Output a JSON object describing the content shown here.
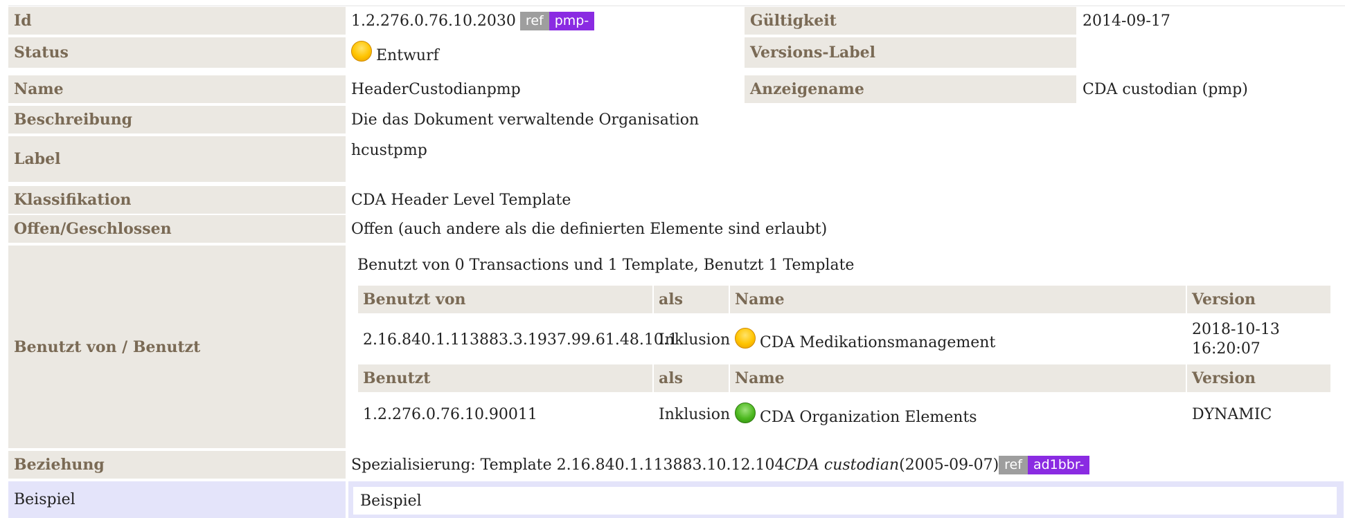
{
  "rows": {
    "id": {
      "label": "Id",
      "value": "1.2.276.0.76.10.2030",
      "ref": "ref",
      "prefix": "pmp-"
    },
    "gueltigkeit": {
      "label": "Gültigkeit",
      "value": "2014-09-17"
    },
    "status": {
      "label": "Status",
      "value": "Entwurf",
      "status_color": "#ffc400"
    },
    "versions_label": {
      "label": "Versions-Label",
      "value": ""
    },
    "name": {
      "label": "Name",
      "value": "HeaderCustodianpmp"
    },
    "anzeigename": {
      "label": "Anzeigename",
      "value": "CDA custodian (pmp)"
    },
    "beschreibung": {
      "label": "Beschreibung",
      "value": "Die das Dokument verwaltende Organisation"
    },
    "label": {
      "label": "Label",
      "value": "hcustpmp"
    },
    "klassifikation": {
      "label": "Klassifikation",
      "value": "CDA Header Level Template"
    },
    "offen": {
      "label": "Offen/Geschlossen",
      "value": "Offen (auch andere als die definierten Elemente sind erlaubt)"
    },
    "benutzt": {
      "label": "Benutzt von / Benutzt",
      "summary": "Benutzt von 0 Transactions und 1 Template, Benutzt 1 Template",
      "used_by_headers": {
        "col1": "Benutzt von",
        "col2": "als",
        "col3": "Name",
        "col4": "Version"
      },
      "used_by_rows": [
        {
          "id": "2.16.840.1.113883.3.1937.99.61.48.10.1",
          "als": "Inklusion",
          "name": "CDA Medikationsmanagement",
          "status_color": "#ffc400",
          "version_line1": "2018-10-13",
          "version_line2": "16:20:07"
        }
      ],
      "uses_headers": {
        "col1": "Benutzt",
        "col2": "als",
        "col3": "Name",
        "col4": "Version"
      },
      "uses_rows": [
        {
          "id": "1.2.276.0.76.10.90011",
          "als": "Inklusion",
          "name": "CDA Organization Elements",
          "status_color": "#4cb81f",
          "version": "DYNAMIC"
        }
      ]
    },
    "beziehung": {
      "label": "Beziehung",
      "prefix_text": "Spezialisierung: Template 2.16.840.1.113883.10.12.104",
      "template_name": "CDA custodian",
      "date": "(2005-09-07)",
      "ref": "ref",
      "prefix": "ad1bbr-"
    },
    "beispiel": {
      "label": "Beispiel",
      "value": "Beispiel"
    }
  }
}
